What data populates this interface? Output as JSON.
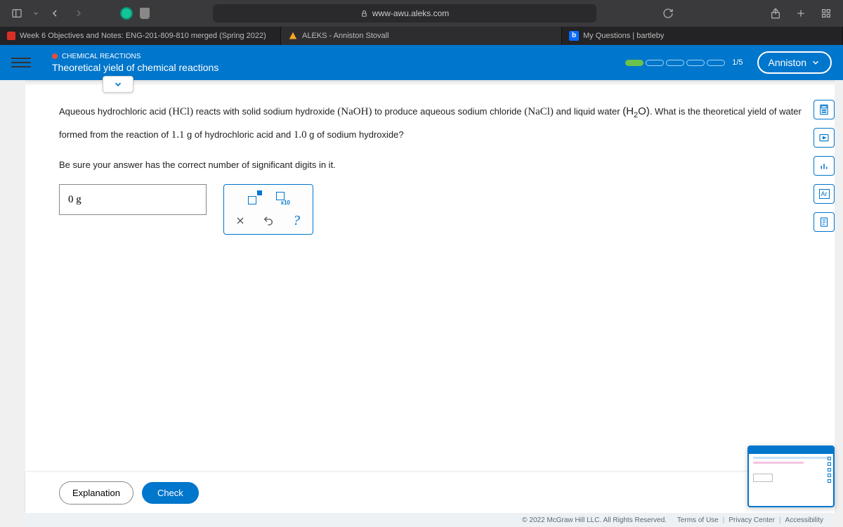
{
  "browser": {
    "url": "www-awu.aleks.com"
  },
  "tabs": [
    {
      "label": "Week 6 Objectives and Notes: ENG-201-809-810 merged (Spring 2022)"
    },
    {
      "label": "ALEKS - Anniston Stovall"
    },
    {
      "label": "My Questions | bartleby"
    }
  ],
  "header": {
    "category": "CHEMICAL REACTIONS",
    "title": "Theoretical yield of chemical reactions",
    "progress": "1/5",
    "user": "Anniston"
  },
  "question": {
    "p1_a": "Aqueous hydrochloric acid ",
    "chem1": "(HCl)",
    "p1_b": " reacts with solid sodium hydroxide ",
    "chem2": "(NaOH)",
    "p1_c": " to produce aqueous sodium chloride ",
    "chem3": "(NaCl)",
    "p1_d": " and liquid water ",
    "chem4_part1": "(H",
    "chem4_sub": "2",
    "chem4_part2": "O)",
    "p1_e": ". What is the theoretical yield of water formed from the reaction of ",
    "num1": "1.1",
    "p1_f": " g of hydrochloric acid and ",
    "num2": "1.0",
    "p1_g": " g of sodium hydroxide?",
    "note": "Be sure your answer has the correct number of significant digits in it."
  },
  "answer": {
    "value": "0 g"
  },
  "actions": {
    "explanation": "Explanation",
    "check": "Check"
  },
  "footer": {
    "copyright": "© 2022 McGraw Hill LLC. All Rights Reserved.",
    "terms": "Terms of Use",
    "privacy": "Privacy Center",
    "accessibility": "Accessibility"
  }
}
